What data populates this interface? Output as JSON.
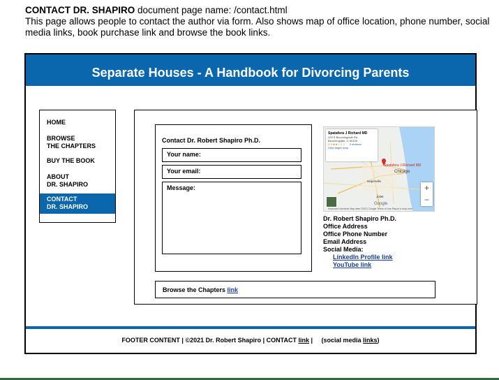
{
  "intro": {
    "title": "CONTACT DR. SHAPIRO",
    "page_name": " document page name: /contact.html",
    "description": "This page allows people to contact the author via form. Also shows map of office location, phone number, social media links, book purchase link and browse the book links."
  },
  "header": {
    "title": "Separate Houses - A Handbook for Divorcing Parents"
  },
  "nav": {
    "items": [
      {
        "line1": "HOME",
        "line2": ""
      },
      {
        "line1": "BROWSE",
        "line2": "THE CHAPTERS"
      },
      {
        "line1": "BUY THE BOOK",
        "line2": ""
      },
      {
        "line1": "ABOUT",
        "line2": "DR. SHAPIRO"
      },
      {
        "line1": "CONTACT",
        "line2": "DR. SHAPIRO"
      }
    ]
  },
  "form": {
    "title": "Contact Dr. Robert Shapiro Ph.D.",
    "name_label": "Your name:",
    "email_label": "Your email:",
    "message_label": "Message:"
  },
  "map": {
    "card_title": "Spatafora J Richard MD",
    "card_address1": "125 S Bloomingdale Rd,",
    "card_address2": "Bloomingdale, IL 60108",
    "card_rating": "2.3 ★★☆☆☆",
    "card_reviews": "3 reviews",
    "card_link": "View larger map",
    "place_label": "Spatafora J Richard MD",
    "city_label": "Chicago",
    "town_label": "Naperville",
    "town2_label": "Joliet",
    "zoom_in": "+",
    "zoom_out": "−",
    "logo": "Google",
    "footer_text": "Keyboard shortcuts   Map data ©2021 Google   Terms of Use   Report a map error"
  },
  "info": {
    "name": "Dr. Robert Shapiro Ph.D.",
    "address": "Office Address",
    "phone": "Office Phone Number",
    "email": "Email Address",
    "social_label": "Social Media:",
    "linkedin": "LinkedIn Profile link",
    "youtube": "YouTube link"
  },
  "browse": {
    "text": "Browse the Chapters ",
    "link": "link"
  },
  "footer": {
    "prefix": "FOOTER CONTENT  |  ©2021 Dr. Robert Shapiro  |  CONTACT ",
    "contact_link": "link",
    "middle": " |     (social media ",
    "social_link": "links",
    "suffix": ")"
  },
  "colors": {
    "brand_blue": "#0a67ad",
    "link_blue": "#1a3f9e",
    "bottom_rule": "#2e6b3c"
  }
}
